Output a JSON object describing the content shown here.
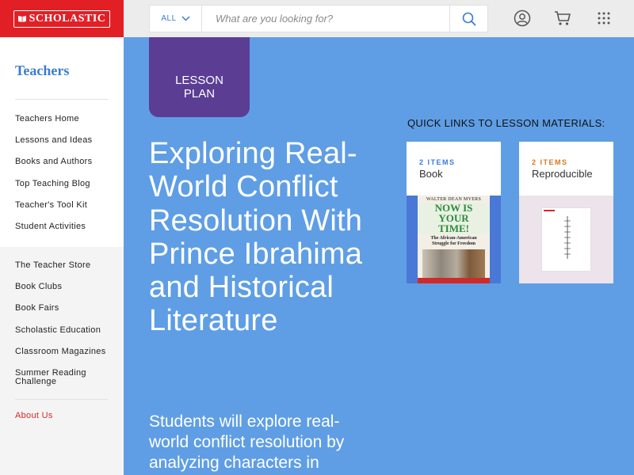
{
  "header": {
    "logo_text": "SCHOLASTIC",
    "search": {
      "scope": "ALL",
      "placeholder": "What are you looking for?"
    },
    "icons": [
      "user-icon",
      "cart-icon",
      "apps-grid-icon"
    ]
  },
  "sidebar": {
    "title": "Teachers",
    "primary_items": [
      "Teachers Home",
      "Lessons and Ideas",
      "Books and Authors",
      "Top Teaching Blog",
      "Teacher's Tool Kit",
      "Student Activities"
    ],
    "secondary_items": [
      "The Teacher Store",
      "Book Clubs",
      "Book Fairs",
      "Scholastic Education",
      "Classroom Magazines",
      "Summer Reading Challenge"
    ],
    "about": "About Us"
  },
  "main": {
    "badge_line1": "LESSON",
    "badge_line2": "PLAN",
    "title": "Exploring Real-World Conflict Resolution With Prince Ibrahima and Historical Literature",
    "description": "Students will explore real-world conflict resolution by analyzing characters in historical literature and",
    "quick_links_title": "QUICK LINKS TO LESSON MATERIALS:",
    "cards": [
      {
        "count": "2 ITEMS",
        "label": "Book",
        "cover": {
          "author": "WALTER DEAN MYERS",
          "title_line1": "NOW IS",
          "title_line2": "YOUR",
          "title_line3": "TIME!",
          "subtitle_line1": "The African-American",
          "subtitle_line2": "Struggle for Freedom"
        }
      },
      {
        "count": "2 ITEMS",
        "label": "Reproducible"
      }
    ]
  },
  "colors": {
    "brand_red": "#e31f26",
    "page_blue": "#5f9ee5",
    "badge_purple": "#5b3d94",
    "link_blue": "#3a7bd5",
    "accent_orange": "#d9771e"
  }
}
